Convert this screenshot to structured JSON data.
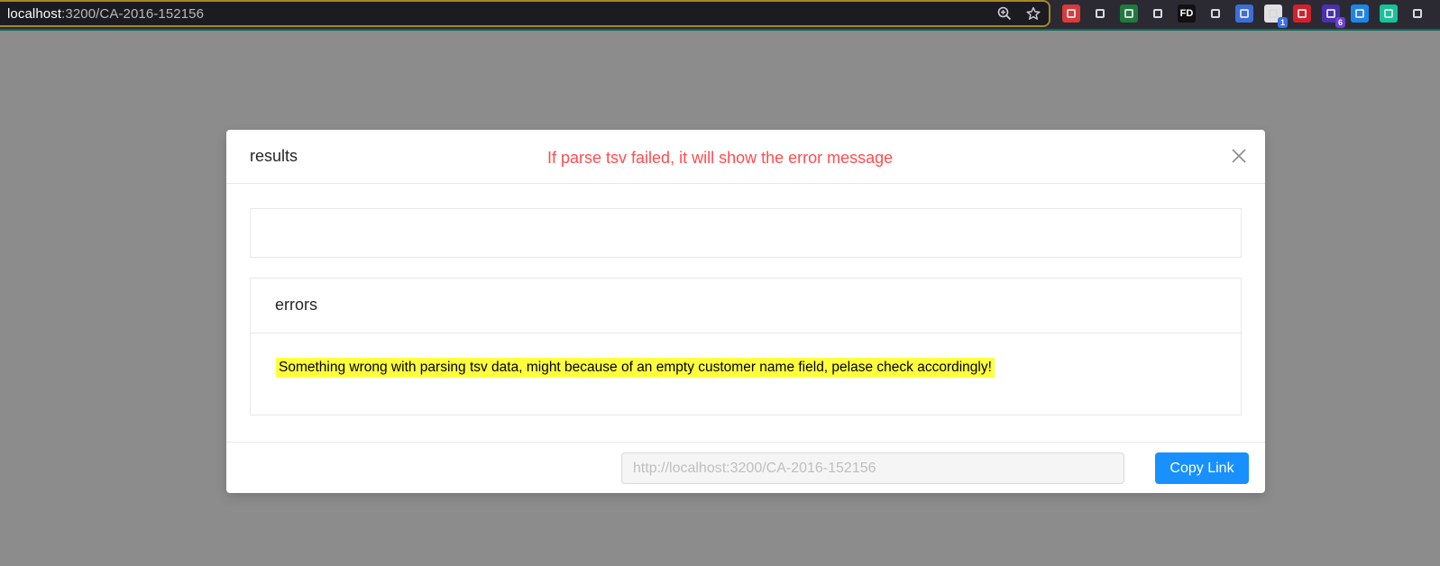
{
  "browser": {
    "url_host": "localhost",
    "url_path": ":3200/CA-2016-152156",
    "icons": [
      "zoom-icon",
      "star-icon"
    ],
    "extensions": [
      {
        "name": "ext-red-icon",
        "color": "#d93a3a",
        "label": "",
        "badge": ""
      },
      {
        "name": "ext-dotted-icon",
        "color": "#2b2a33",
        "label": "",
        "badge": ""
      },
      {
        "name": "ext-green-square-icon",
        "color": "#1f7a3c",
        "label": "",
        "badge": ""
      },
      {
        "name": "pocket-icon",
        "color": "#2b2a33",
        "label": "",
        "badge": ""
      },
      {
        "name": "fd-icon",
        "color": "#111111",
        "label": "FD",
        "badge": ""
      },
      {
        "name": "camera-icon",
        "color": "#2b2a33",
        "label": "",
        "badge": ""
      },
      {
        "name": "ext-picture-icon",
        "color": "#3a6fd8",
        "label": "",
        "badge": ""
      },
      {
        "name": "ext-arrow-icon",
        "color": "#e0e0e0",
        "label": "",
        "badge": "1"
      },
      {
        "name": "ext-red-play-icon",
        "color": "#d4202a",
        "label": "",
        "badge": ""
      },
      {
        "name": "ext-purple-icon",
        "color": "#4a2fb0",
        "label": "",
        "badge": "6"
      },
      {
        "name": "ext-hex-icon",
        "color": "#1c86e8",
        "label": "",
        "badge": ""
      },
      {
        "name": "grammarly-icon",
        "color": "#15c39a",
        "label": "",
        "badge": ""
      },
      {
        "name": "ext-triangle-icon",
        "color": "#2b2a33",
        "label": "",
        "badge": ""
      }
    ]
  },
  "modal": {
    "title": "results",
    "annotation": "If parse tsv failed, it will show the error message",
    "errors": {
      "title": "errors",
      "message": "Something wrong with parsing tsv data, might because of an empty customer name field, pelase check accordingly!"
    },
    "footer": {
      "link_value": "http://localhost:3200/CA-2016-152156",
      "copy_label": "Copy Link"
    }
  },
  "colors": {
    "overlay": "#8c8c8c",
    "annotation": "#ff4d4f",
    "highlight": "#ffff3d",
    "primary": "#1890ff"
  }
}
